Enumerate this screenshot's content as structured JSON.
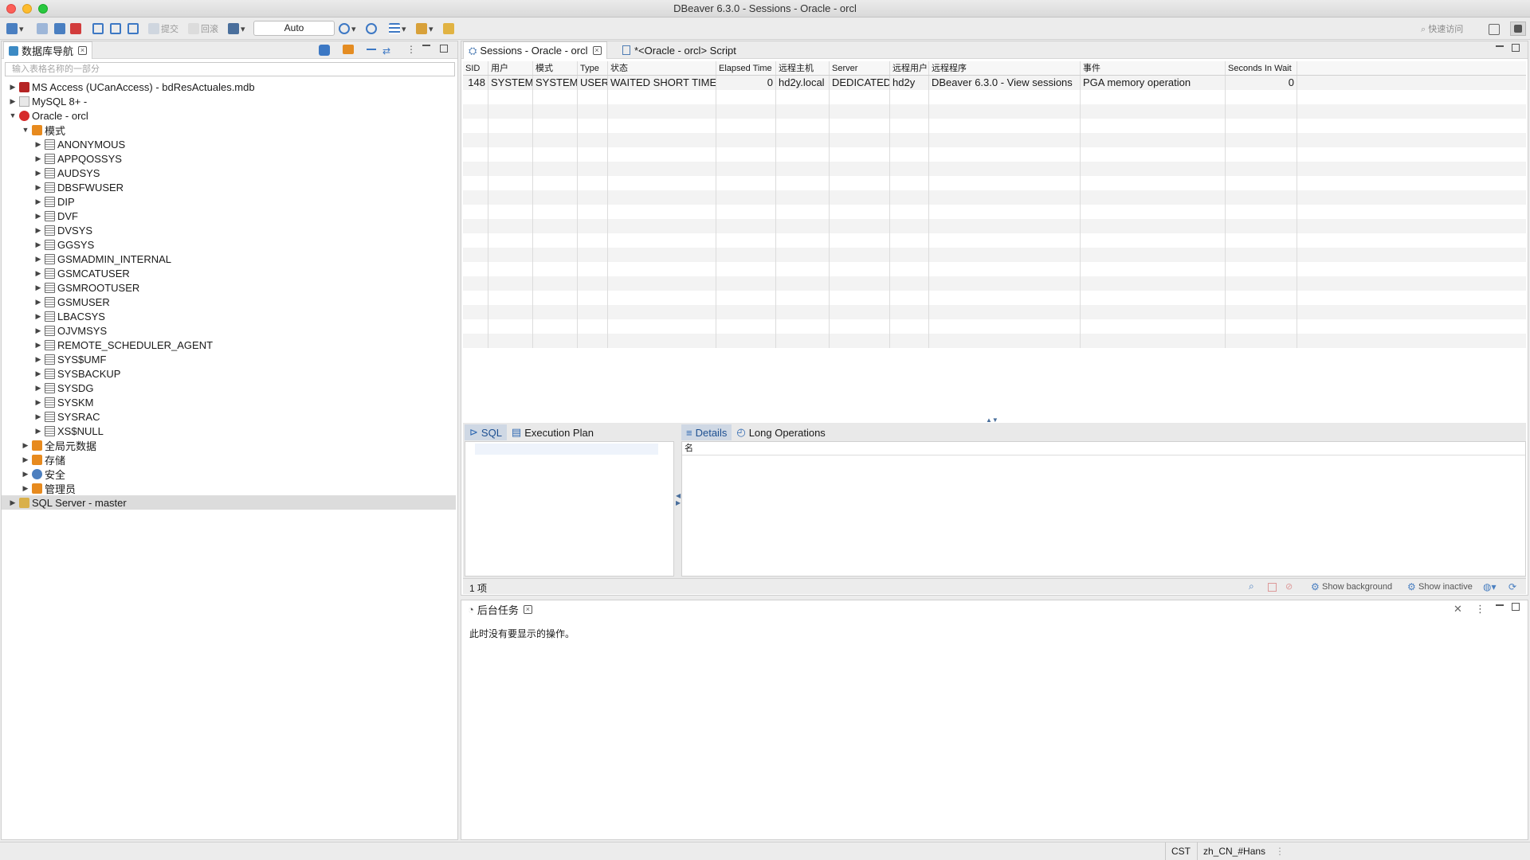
{
  "window": {
    "title": "DBeaver 6.3.0 - Sessions - Oracle - orcl"
  },
  "toolbar": {
    "commit_label": "提交",
    "rollback_label": "回滚",
    "mode_label": "Auto",
    "quick_access": "快速访问"
  },
  "navigator": {
    "title": "数据库导航",
    "filter_placeholder": "输入表格名称的一部分",
    "tree": [
      {
        "label": "MS Access (UCanAccess) - bdResActuales.mdb",
        "level": 0,
        "expanded": false,
        "icon": "access-icon"
      },
      {
        "label": "MySQL 8+ -",
        "level": 0,
        "expanded": false,
        "icon": "mysql-icon"
      },
      {
        "label": "Oracle - orcl",
        "level": 0,
        "expanded": true,
        "icon": "oracle-icon"
      },
      {
        "label": "模式",
        "level": 1,
        "expanded": true,
        "icon": "folder-icon"
      },
      {
        "label": "ANONYMOUS",
        "level": 2,
        "expanded": false,
        "icon": "schema-icon"
      },
      {
        "label": "APPQOSSYS",
        "level": 2,
        "expanded": false,
        "icon": "schema-icon"
      },
      {
        "label": "AUDSYS",
        "level": 2,
        "expanded": false,
        "icon": "schema-icon"
      },
      {
        "label": "DBSFWUSER",
        "level": 2,
        "expanded": false,
        "icon": "schema-icon"
      },
      {
        "label": "DIP",
        "level": 2,
        "expanded": false,
        "icon": "schema-icon"
      },
      {
        "label": "DVF",
        "level": 2,
        "expanded": false,
        "icon": "schema-icon"
      },
      {
        "label": "DVSYS",
        "level": 2,
        "expanded": false,
        "icon": "schema-icon"
      },
      {
        "label": "GGSYS",
        "level": 2,
        "expanded": false,
        "icon": "schema-icon"
      },
      {
        "label": "GSMADMIN_INTERNAL",
        "level": 2,
        "expanded": false,
        "icon": "schema-icon"
      },
      {
        "label": "GSMCATUSER",
        "level": 2,
        "expanded": false,
        "icon": "schema-icon"
      },
      {
        "label": "GSMROOTUSER",
        "level": 2,
        "expanded": false,
        "icon": "schema-icon"
      },
      {
        "label": "GSMUSER",
        "level": 2,
        "expanded": false,
        "icon": "schema-icon"
      },
      {
        "label": "LBACSYS",
        "level": 2,
        "expanded": false,
        "icon": "schema-icon"
      },
      {
        "label": "OJVMSYS",
        "level": 2,
        "expanded": false,
        "icon": "schema-icon"
      },
      {
        "label": "REMOTE_SCHEDULER_AGENT",
        "level": 2,
        "expanded": false,
        "icon": "schema-icon"
      },
      {
        "label": "SYS$UMF",
        "level": 2,
        "expanded": false,
        "icon": "schema-icon"
      },
      {
        "label": "SYSBACKUP",
        "level": 2,
        "expanded": false,
        "icon": "schema-icon"
      },
      {
        "label": "SYSDG",
        "level": 2,
        "expanded": false,
        "icon": "schema-icon"
      },
      {
        "label": "SYSKM",
        "level": 2,
        "expanded": false,
        "icon": "schema-icon"
      },
      {
        "label": "SYSRAC",
        "level": 2,
        "expanded": false,
        "icon": "schema-icon"
      },
      {
        "label": "XS$NULL",
        "level": 2,
        "expanded": false,
        "icon": "schema-icon"
      },
      {
        "label": "全局元数据",
        "level": 1,
        "expanded": false,
        "icon": "folder-icon"
      },
      {
        "label": "存储",
        "level": 1,
        "expanded": false,
        "icon": "folder-icon"
      },
      {
        "label": "安全",
        "level": 1,
        "expanded": false,
        "icon": "shield-icon"
      },
      {
        "label": "管理员",
        "level": 1,
        "expanded": false,
        "icon": "folder-icon"
      },
      {
        "label": "SQL Server - master",
        "level": 0,
        "expanded": false,
        "icon": "sqlserver-icon",
        "selected": true
      }
    ]
  },
  "editor_tabs": [
    {
      "label": "Sessions - Oracle - orcl",
      "active": true
    },
    {
      "label": "*<Oracle - orcl> Script",
      "active": false
    }
  ],
  "sessions": {
    "columns": [
      "SID",
      "用户",
      "模式",
      "Type",
      "状态",
      "Elapsed Time",
      "远程主机",
      "Server",
      "远程用户",
      "远程程序",
      "事件",
      "Seconds In Wait"
    ],
    "rows": [
      [
        "148",
        "SYSTEM",
        "SYSTEM",
        "USER",
        "WAITED SHORT TIME",
        "0",
        "hd2y.local",
        "DEDICATED",
        "hd2y",
        "DBeaver 6.3.0 - View sessions",
        "PGA memory operation",
        "0"
      ]
    ],
    "empty_rows": 18
  },
  "detail_tabs": {
    "left": [
      {
        "label": "SQL",
        "active": true
      },
      {
        "label": "Execution Plan",
        "active": false
      }
    ],
    "right": [
      {
        "label": "Details",
        "active": true
      },
      {
        "label": "Long Operations",
        "active": false
      }
    ],
    "details_header": "名"
  },
  "session_status": {
    "count": "1 项",
    "show_background": "Show background",
    "show_inactive": "Show inactive"
  },
  "background_tasks": {
    "title": "后台任务",
    "message": "此时没有要显示的操作。"
  },
  "statusbar": {
    "timezone": "CST",
    "locale": "zh_CN_#Hans"
  }
}
